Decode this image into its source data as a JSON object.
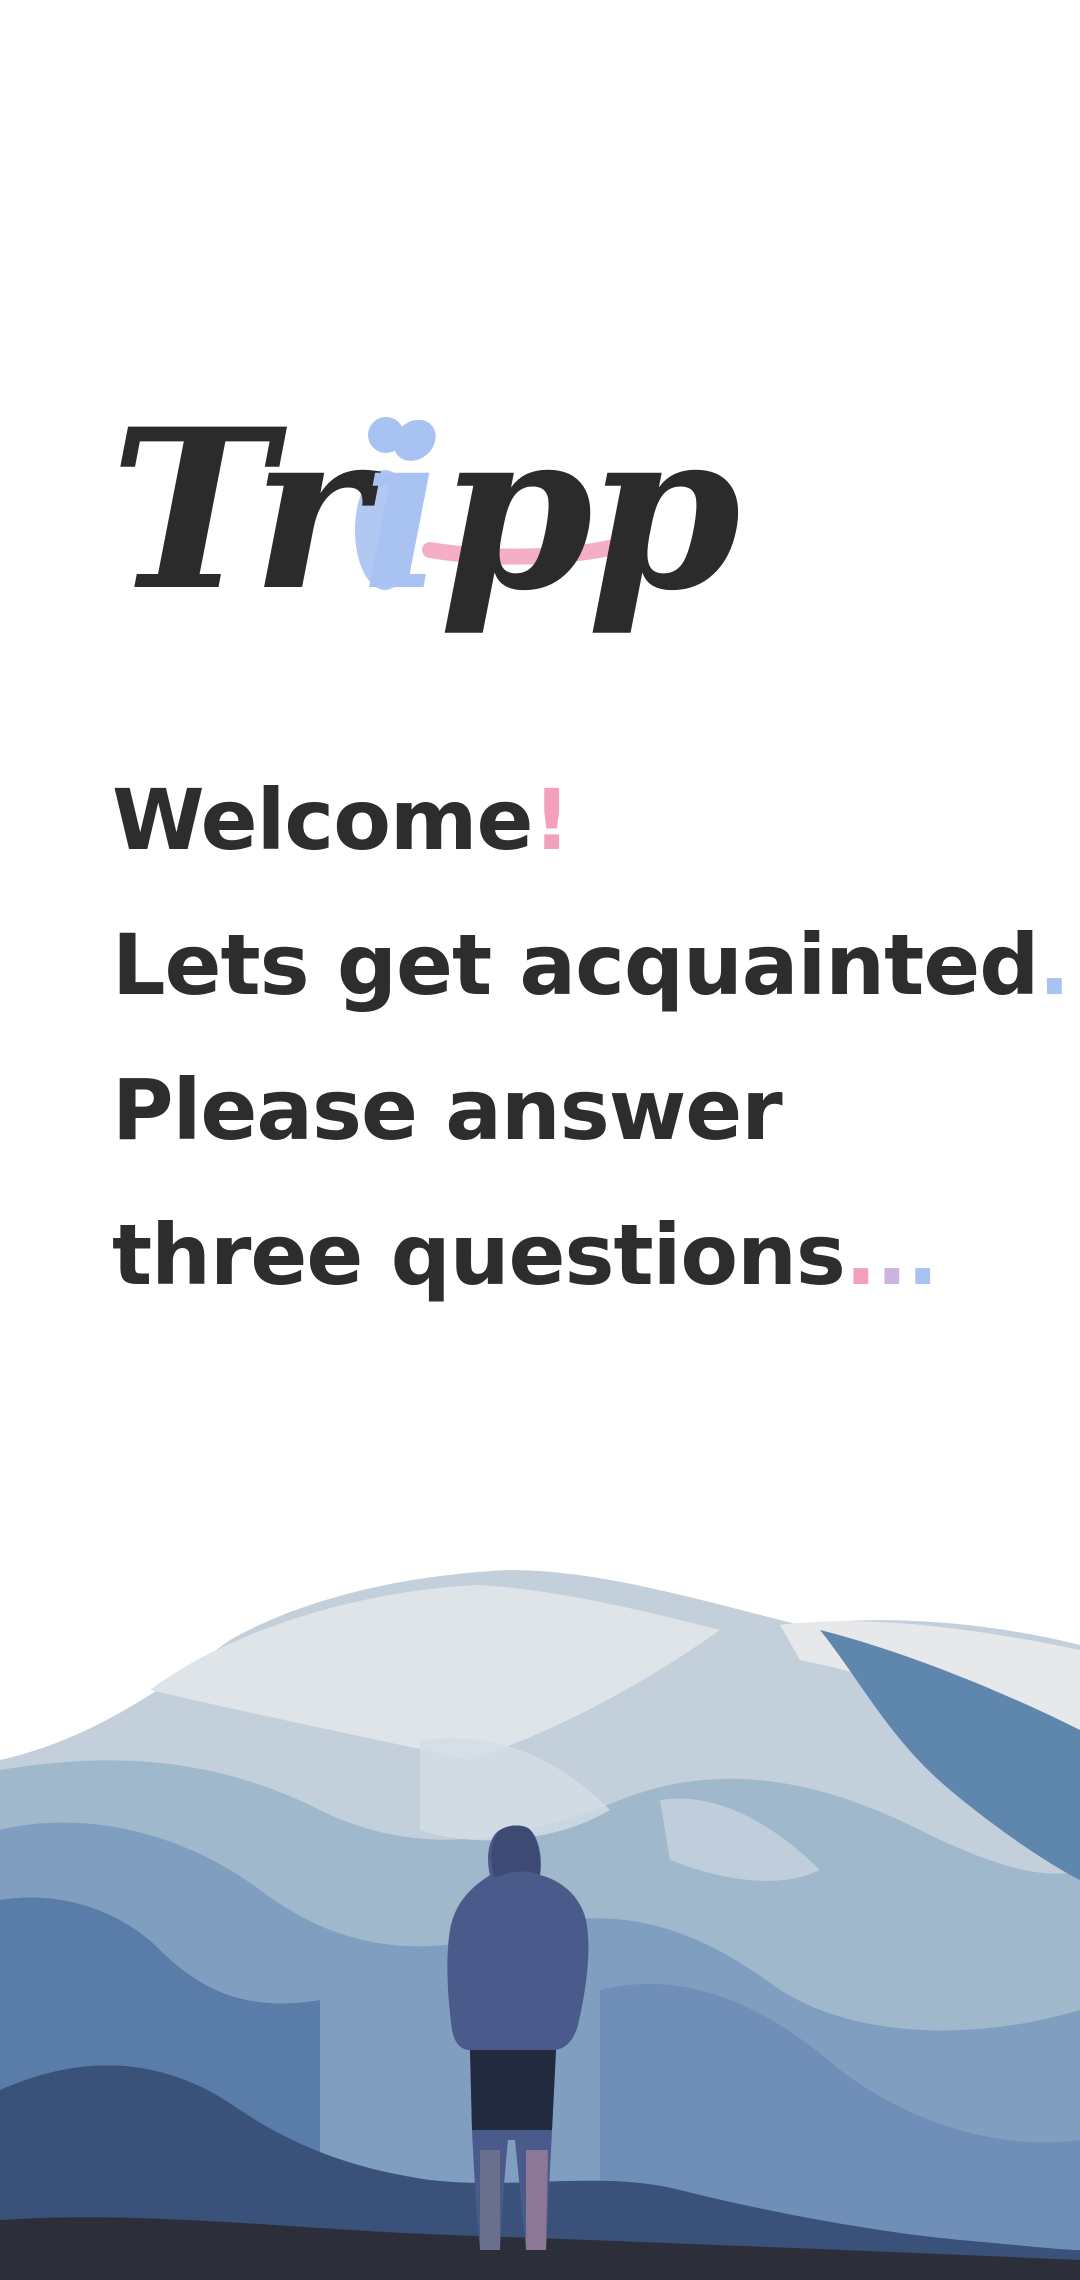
{
  "app": {
    "logo_text": "Tripp",
    "logo_letters": [
      "T",
      "r",
      "i",
      "p",
      "p"
    ]
  },
  "intro": {
    "line1": "Welcome",
    "line1_accent": "!",
    "line2": "Lets get acquainted",
    "line2_accent": ".",
    "line3": "Please answer",
    "line4": "three questions",
    "line4_accent_1": ".",
    "line4_accent_2": ".",
    "line4_accent_3": "."
  },
  "colors": {
    "text": "#2d2d2d",
    "accent_pink": "#f2a0bd",
    "accent_blue": "#a8c2f2",
    "accent_lilac": "#cdb3e0"
  }
}
